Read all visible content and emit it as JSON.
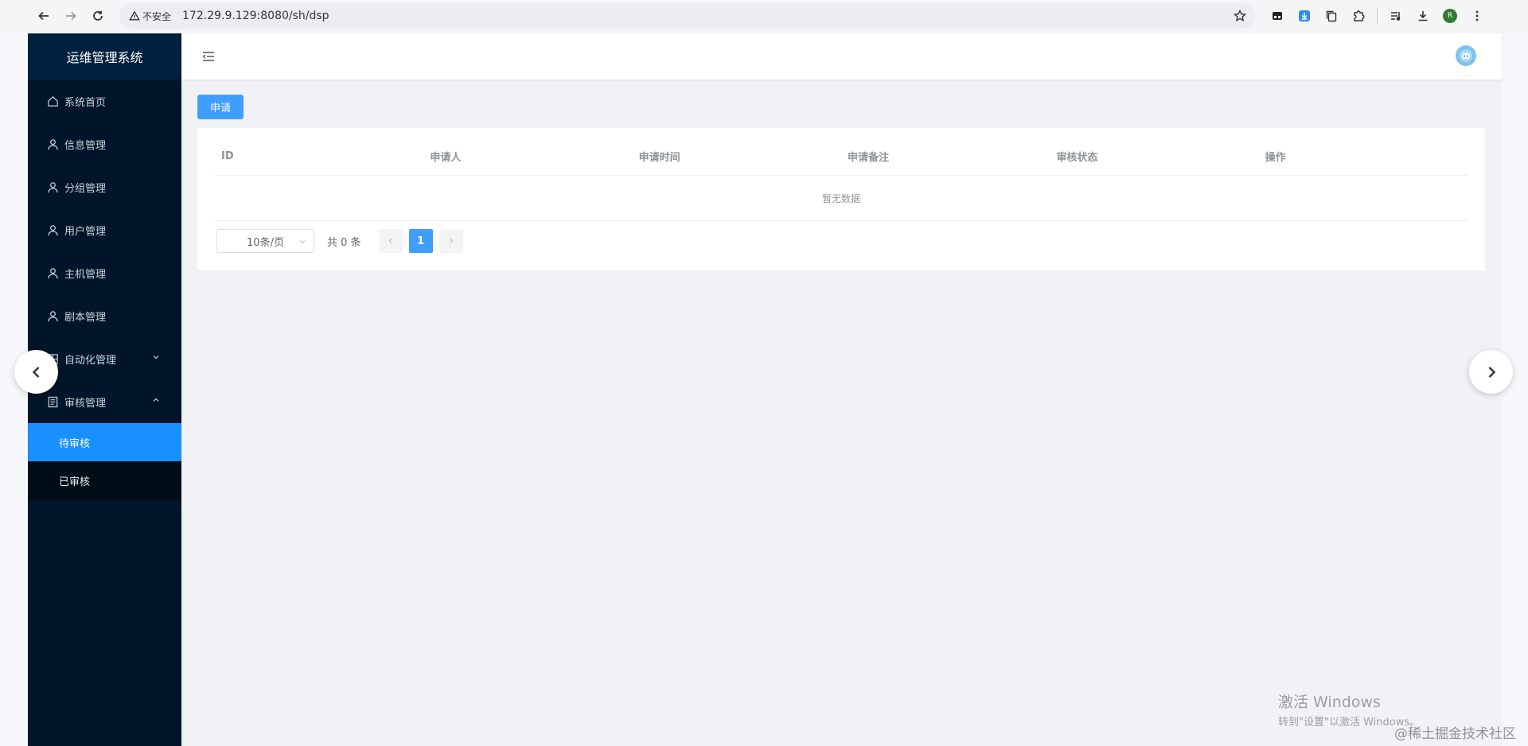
{
  "browser": {
    "insecure_label": "不安全",
    "url": "172.29.9.129:8080/sh/dsp",
    "profile_initial": "R"
  },
  "app": {
    "title": "运维管理系统"
  },
  "sidebar": {
    "items": [
      {
        "label": "系统首页",
        "icon": "home-icon"
      },
      {
        "label": "信息管理",
        "icon": "user-icon"
      },
      {
        "label": "分组管理",
        "icon": "user-icon"
      },
      {
        "label": "用户管理",
        "icon": "user-icon"
      },
      {
        "label": "主机管理",
        "icon": "user-icon"
      },
      {
        "label": "剧本管理",
        "icon": "user-icon"
      },
      {
        "label": "自动化管理",
        "icon": "grid-icon",
        "expanded": false
      },
      {
        "label": "审核管理",
        "icon": "document-icon",
        "expanded": true
      }
    ],
    "subitems": [
      {
        "label": "待审核",
        "active": true
      },
      {
        "label": "已审核",
        "active": false
      }
    ]
  },
  "toolbar": {
    "apply_label": "申请"
  },
  "table": {
    "columns": [
      "ID",
      "申请人",
      "申请时间",
      "申请备注",
      "审核状态",
      "操作"
    ],
    "rows": [],
    "empty_text": "暂无数据"
  },
  "pagination": {
    "page_size": "10条/页",
    "total": "共 0 条",
    "current_page": "1"
  },
  "watermark": {
    "title": "激活 Windows",
    "subtitle": "转到\"设置\"以激活 Windows。"
  },
  "credit": "@稀土掘金技术社区",
  "colors": {
    "sidebar_bg": "#001529",
    "active_item": "#1890ff",
    "primary": "#409eff"
  }
}
